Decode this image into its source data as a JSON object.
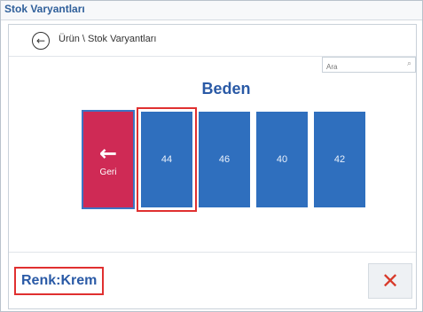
{
  "window": {
    "title": "Stok Varyantları"
  },
  "breadcrumb": {
    "back_icon": "←",
    "text": "Ürün \\ Stok Varyantları"
  },
  "search": {
    "placeholder": "Ara",
    "icon": "⌕"
  },
  "group": {
    "title": "Beden"
  },
  "back_tile": {
    "arrow": "←",
    "label": "Geri"
  },
  "sizes": [
    "44",
    "46",
    "40",
    "42"
  ],
  "footer": {
    "color_label": "Renk:Krem",
    "close_icon": "✕"
  },
  "colors": {
    "accent_blue": "#2f6fbe",
    "back_red": "#cf2a55",
    "highlight_red": "#e03030",
    "close_red": "#d83a2a"
  }
}
